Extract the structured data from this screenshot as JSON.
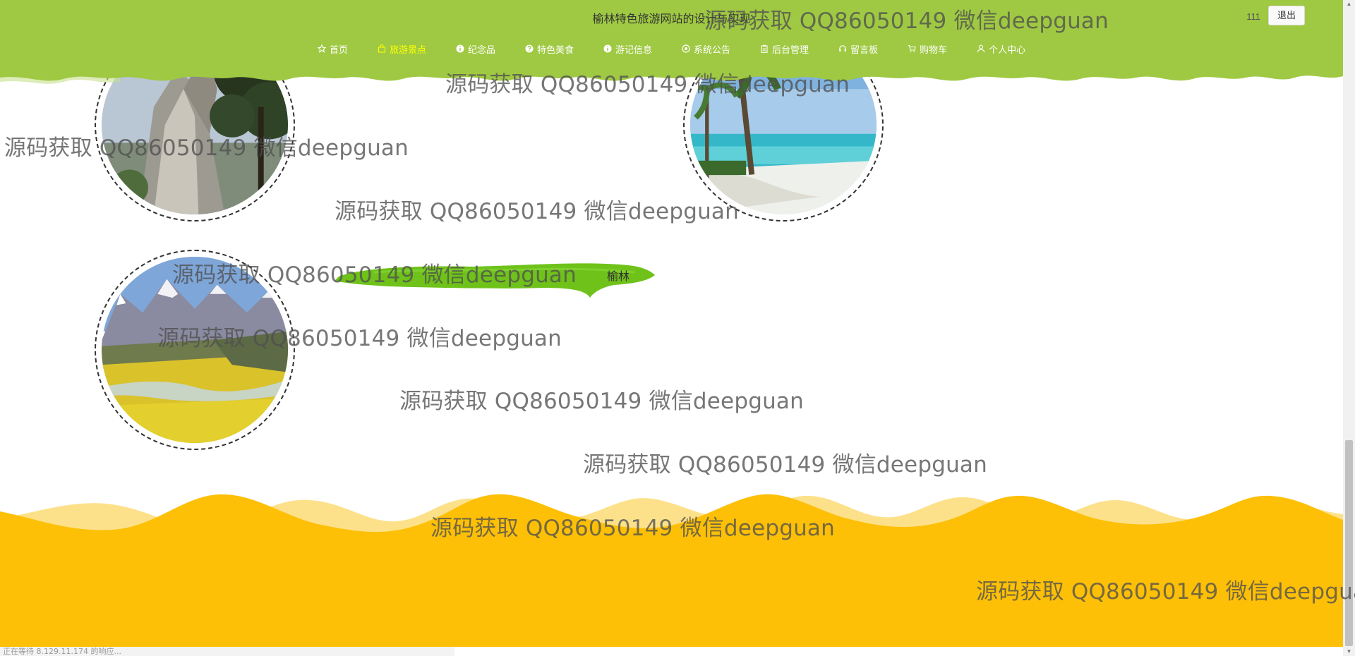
{
  "header": {
    "title": "榆林特色旅游网站的设计与实现",
    "user_name": "111",
    "logout_label": "退出",
    "bg_color": "#9fc943",
    "active_color": "#ffff00"
  },
  "nav": {
    "items": [
      {
        "label": "首页",
        "icon": "star-icon"
      },
      {
        "label": "旅游景点",
        "icon": "bag-icon",
        "active": true
      },
      {
        "label": "纪念品",
        "icon": "info-icon"
      },
      {
        "label": "特色美食",
        "icon": "question-icon"
      },
      {
        "label": "游记信息",
        "icon": "info-icon"
      },
      {
        "label": "系统公告",
        "icon": "compass-icon"
      },
      {
        "label": "后台管理",
        "icon": "clipboard-icon"
      },
      {
        "label": "留言板",
        "icon": "headset-icon"
      },
      {
        "label": "购物车",
        "icon": "cart-icon"
      },
      {
        "label": "个人中心",
        "icon": "user-icon"
      }
    ]
  },
  "main": {
    "brush_label": "榆林",
    "brush_color": "#6fc21a"
  },
  "footer": {
    "wave_color": "#fdc007",
    "wave_light_color": "#fde18a"
  },
  "watermark": {
    "text": "源码获取 QQ86050149 微信deepguan"
  },
  "status_bar": {
    "text": "正在等待 8.129.11.174 的响应..."
  }
}
